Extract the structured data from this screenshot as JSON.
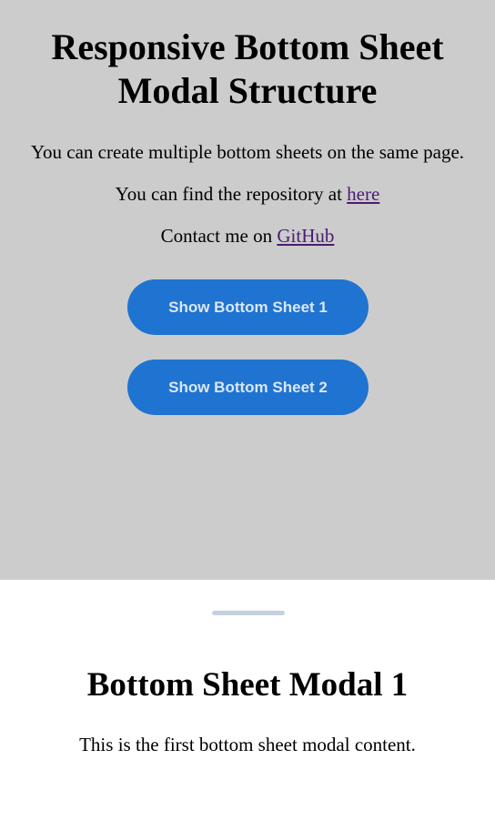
{
  "main": {
    "title": "Responsive Bottom Sheet Modal Structure",
    "intro": "You can create multiple bottom sheets on the same page.",
    "repo_prefix": "You can find the repository at ",
    "repo_link": "here",
    "contact_prefix": "Contact me on ",
    "contact_link": "GitHub",
    "buttons": [
      {
        "label": "Show Bottom Sheet 1"
      },
      {
        "label": "Show Bottom Sheet 2"
      }
    ]
  },
  "sheet": {
    "title": "Bottom Sheet Modal 1",
    "content": "This is the first bottom sheet modal content."
  },
  "colors": {
    "backdrop": "#cccccc",
    "button_bg": "#1f73d1",
    "button_text": "#dbe7f5",
    "link": "#4b1c73",
    "handle": "#c6d1df"
  }
}
